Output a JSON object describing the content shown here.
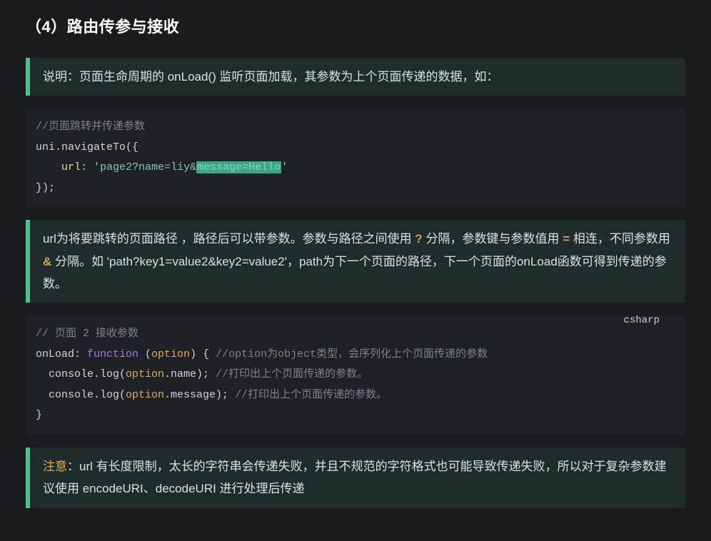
{
  "heading": "（4）路由传参与接收",
  "quote1": {
    "text": "说明：页面生命周期的 onLoad() 监听页面加载，其参数为上个页面传递的数据，如："
  },
  "code1": {
    "comment": "//页面跳转并传递参数",
    "line1_a": "uni.navigateTo({",
    "line2_key": "url",
    "line2_colon": ": ",
    "line2_q1": "'",
    "line2_str_a": "page2?name=liy&",
    "line2_str_sel": "message=Hello",
    "line2_q2": "'",
    "line3": "});"
  },
  "quote2": {
    "p1_a": "url为将要跳转的页面路径 ，路径后可以带参数。参数与路径之间使用 ",
    "p1_q": "?",
    "p1_b": " 分隔，参数键与参数值用 ",
    "p1_eq": "=",
    "p1_c": " 相连，不同参数用 ",
    "p1_amp": "&",
    "p1_d": " 分隔。如 'path?key1=value2&key2=value2'，path为下一个页面的路径，下一个页面的onLoad函数可得到传递的参数。"
  },
  "code2": {
    "lang": "csharp",
    "c_top": "// 页面 2 接收参数",
    "l1_a": "onLoad: ",
    "l1_kw": "function",
    "l1_b": " (",
    "l1_param": "option",
    "l1_c": ") { ",
    "l1_cm": "//option为object类型，会序列化上个页面传递的参数",
    "l2_a": "  console.log(",
    "l2_obj": "option",
    "l2_b": ".name); ",
    "l2_cm": "//打印出上个页面传递的参数。",
    "l3_a": "  console.log(",
    "l3_obj": "option",
    "l3_b": ".message); ",
    "l3_cm": "//打印出上个页面传递的参数。",
    "l4": "}"
  },
  "quote3": {
    "warn": "注意",
    "rest": "：url 有长度限制，太长的字符串会传递失败，并且不规范的字符格式也可能导致传递失败，所以对于复杂参数建议使用 encodeURI、decodeURI 进行处理后传递"
  }
}
